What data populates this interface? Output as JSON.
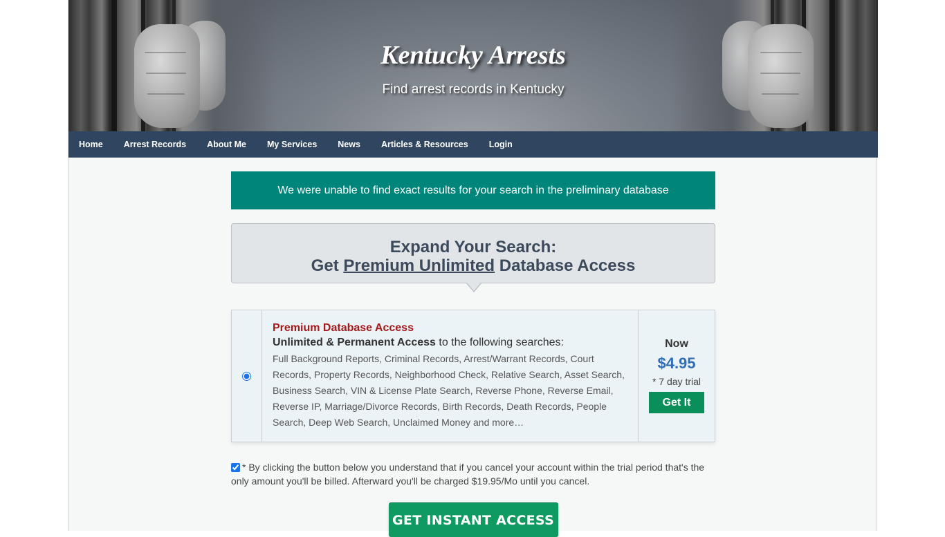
{
  "header": {
    "title": "Kentucky Arrests",
    "subtitle": "Find arrest records in Kentucky"
  },
  "nav": {
    "items": [
      {
        "label": "Home"
      },
      {
        "label": "Arrest Records"
      },
      {
        "label": "About Me"
      },
      {
        "label": "My Services"
      },
      {
        "label": "News"
      },
      {
        "label": "Articles & Resources"
      },
      {
        "label": "Login"
      }
    ]
  },
  "alert": {
    "message": "We were unable to find exact results for your search in the preliminary database"
  },
  "expand": {
    "line1": "Expand Your Search:",
    "line2_prefix": "Get",
    "line2_link": "Premium Unlimited",
    "line2_suffix": "Database Access"
  },
  "offer": {
    "selected": true,
    "title": "Premium Database Access",
    "lead_bold": "Unlimited & Permanent Access",
    "lead_rest": " to the following searches:",
    "list": "Full Background Reports, Criminal Records, Arrest/Warrant Records, Court Records, Property Records, Neighborhood Check, Relative Search, Asset Search, Business Search, VIN & License Plate Search, Reverse Phone, Reverse Email, Reverse IP, Marriage/Divorce Records, Birth Records, Death Records, People Search, Deep Web Search, Unclaimed Money and more…",
    "now_label": "Now",
    "price": "$4.95",
    "trial": "* 7 day trial",
    "button_label": "Get It"
  },
  "terms": {
    "checked": true,
    "text": "* By clicking the button below you understand that if you cancel your account within the trial period that's the only amount you'll be billed. Afterward you'll be charged $19.95/Mo until you cancel."
  },
  "cta": {
    "label": "GET INSTANT ACCESS"
  },
  "colors": {
    "nav_bg": "#2f4560",
    "alert_bg": "#00857a",
    "offer_title": "#a31a1a",
    "price": "#2f6db5",
    "button_green": "#0a8f5a"
  }
}
